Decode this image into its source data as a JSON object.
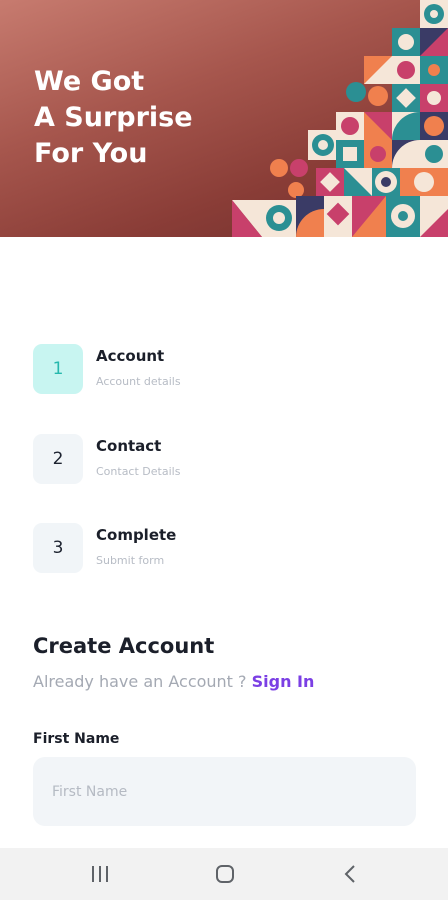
{
  "hero": {
    "title_lines": [
      "We Got",
      "A Surprise",
      "For You"
    ],
    "colors": {
      "background": "#8a3d37",
      "teal": "#2b8f93",
      "pink": "#c8406b",
      "orange": "#f0804e",
      "cream": "#f5e6d8",
      "navy": "#3a3b66"
    }
  },
  "steps": [
    {
      "number": "1",
      "title": "Account",
      "subtitle": "Account details",
      "active": true
    },
    {
      "number": "2",
      "title": "Contact",
      "subtitle": "Contact Details",
      "active": false
    },
    {
      "number": "3",
      "title": "Complete",
      "subtitle": "Submit form",
      "active": false
    }
  ],
  "form": {
    "title": "Create Account",
    "subtitle": "Already have an Account ?",
    "signin_label": "Sign In",
    "first_name": {
      "label": "First Name",
      "placeholder": "First Name",
      "value": ""
    }
  },
  "navbar": {
    "icons": [
      "recent-apps-icon",
      "home-icon",
      "back-icon"
    ]
  },
  "colors": {
    "accent": "#7b3fe4",
    "active_step_bg": "#c8f5f1",
    "active_step_text": "#26b8ad"
  }
}
